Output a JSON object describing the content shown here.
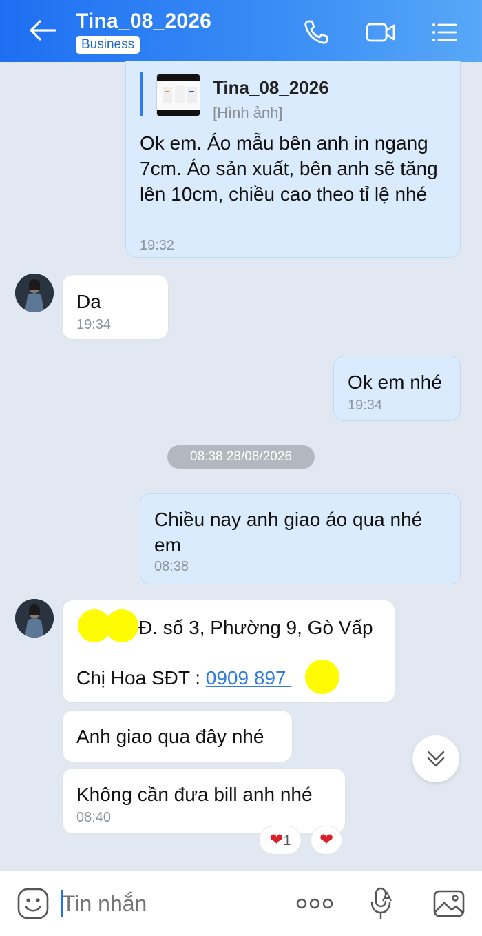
{
  "header": {
    "contact_name": "Tina_08_2026",
    "badge": "Business",
    "icons": [
      "back-arrow-icon",
      "phone-icon",
      "video-camera-icon",
      "list-menu-icon"
    ]
  },
  "messages": [
    {
      "side": "sent",
      "quote": {
        "name": "Tina_08_2026",
        "type": "[Hình ảnh]"
      },
      "text": "Ok em. Áo mẫu bên anh in ngang 7cm. Áo sản xuất, bên anh sẽ tăng lên 10cm, chiều cao theo tỉ lệ nhé",
      "time": "19:32"
    },
    {
      "side": "recv",
      "text": "Da",
      "time": "19:34"
    },
    {
      "side": "sent",
      "text": "Ok em nhé",
      "time": "19:34"
    },
    {
      "side": "sent",
      "text": "Chiều nay anh giao áo qua nhé em",
      "time": "08:38"
    },
    {
      "side": "recv",
      "address": "Đ. số 3, Phường 9, Gò Vấp",
      "contact_prefix": "Chị Hoa SĐT : ",
      "phone": "0909 897"
    },
    {
      "side": "recv",
      "text": "Anh giao qua đây nhé"
    },
    {
      "side": "recv",
      "text": "Không cần đưa bill anh nhé",
      "time": "08:40"
    }
  ],
  "date_separator": "08:38 28/08/2026",
  "reactions": [
    {
      "emoji": "heart",
      "count": "1"
    },
    {
      "emoji": "heart",
      "count": ""
    }
  ],
  "composer": {
    "placeholder": "Tin nhắn",
    "icons": [
      "emoji-icon",
      "more-dots-icon",
      "microphone-icon",
      "image-icon"
    ]
  },
  "colors": {
    "header_blue": "#1e6ff2",
    "sent_bubble": "#daebfd",
    "received_bubble": "#ffffff",
    "background": "#e2e8f1",
    "link": "#2f7fd9",
    "heart": "#d9212b"
  }
}
